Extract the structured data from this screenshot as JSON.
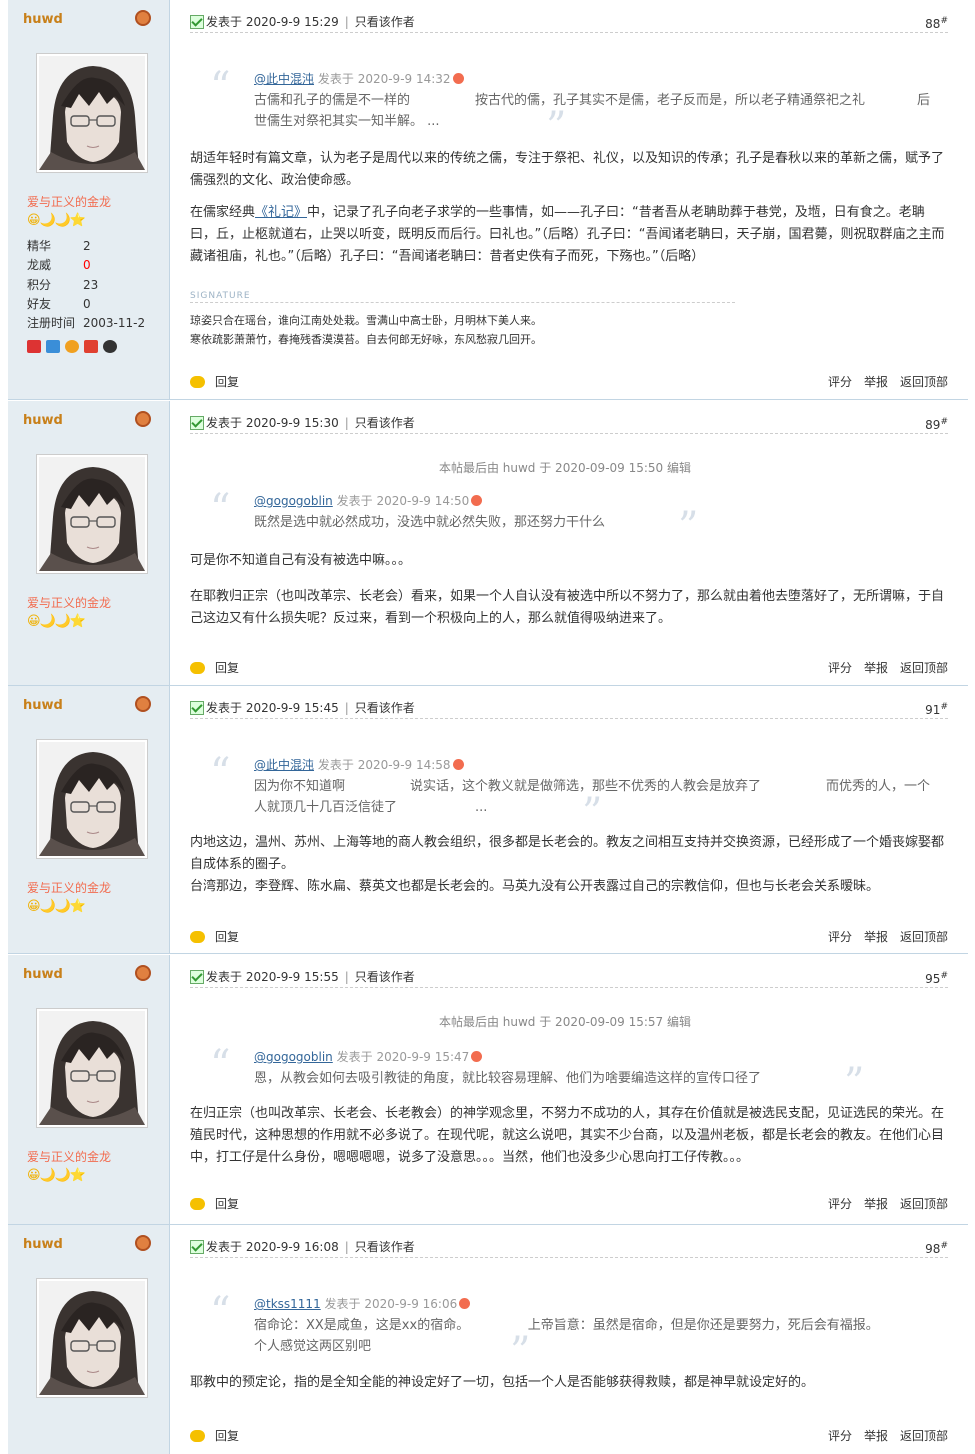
{
  "labels": {
    "posted": "发表于",
    "only_author": "只看该作者",
    "quote_posted": "发表于",
    "reply": "回复",
    "rate": "评分",
    "report": "举报",
    "top": "返回顶部",
    "signature": "SIGNATURE",
    "floor_mark": "#"
  },
  "user": {
    "name": "huwd",
    "rank": "爱与正义的金龙",
    "stars": "😀🌙🌙⭐",
    "stats": [
      {
        "k": "精华",
        "v": "2"
      },
      {
        "k": "龙威",
        "v": "0"
      },
      {
        "k": "积分",
        "v": "23"
      },
      {
        "k": "好友",
        "v": "0"
      },
      {
        "k": "注册时间",
        "v": "2003-11-2"
      }
    ]
  },
  "posts": [
    {
      "floor": "88",
      "time": "2020-9-9 15:29",
      "quote": {
        "user": "@此中混沌",
        "time": "2020-9-9 14:32",
        "text": "古儒和孔子的儒是不一样的　　　　　按古代的儒，孔子其实不是儒，老子反而是，所以老子精通祭祀之礼　　　　后世儒生对祭祀其实一知半解。 ..."
      },
      "p1": "胡适年轻时有篇文章，认为老子是周代以来的传统之儒，专注于祭祀、礼仪，以及知识的传承；孔子是春秋以来的革新之儒，赋予了儒强烈的文化、政治使命感。",
      "p2a": "在儒家经典",
      "p2link": "《礼记》",
      "p2b": "中，记录了孔子向老子求学的一些事情，如——孔子曰：“昔者吾从老聃助葬于巷党，及堩，日有食之。老聃曰，丘，止柩就道右，止哭以听变，既明反而后行。曰礼也。”（后略）孔子曰：“吾闻诸老聃曰，天子崩，国君薨，则祝取群庙之主而藏诸祖庙，礼也。”（后略）孔子曰：“吾闻诸老聃曰：昔者史佚有子而死，下殇也。”（后略）",
      "sig": [
        "琼姿只合在瑶台，谁向江南处处栽。雪满山中高士卧，月明林下美人来。",
        "寒依疏影萧萧竹，春掩残香漠漠苔。自去何郎无好咏，东风愁寂几回开。"
      ]
    },
    {
      "floor": "89",
      "time": "2020-9-9 15:30",
      "edit": "本帖最后由 huwd 于 2020-09-09 15:50 编辑",
      "quote": {
        "user": "@gogogoblin",
        "time": "2020-9-9 14:50",
        "text": "既然是选中就必然成功，没选中就必然失败，那还努力干什么"
      },
      "p1": "可是你不知道自己有没有被选中嘛。。。",
      "p2": "在耶教归正宗（也叫改革宗、长老会）看来，如果一个人自认没有被选中所以不努力了，那么就由着他去堕落好了，无所谓嘛，于自己这边又有什么损失呢？反过来，看到一个积极向上的人，那么就值得吸纳进来了。"
    },
    {
      "floor": "91",
      "time": "2020-9-9 15:45",
      "quote": {
        "user": "@此中混沌",
        "time": "2020-9-9 14:58",
        "text": "因为你不知道啊　　　　　说实话，这个教义就是做筛选，那些不优秀的人教会是放弃了　　　　　而优秀的人，一个人就顶几十几百泛信徒了　　　　　　..."
      },
      "p1": "内地这边，温州、苏州、上海等地的商人教会组织，很多都是长老会的。教友之间相互支持并交换资源，已经形成了一个婚丧嫁娶都自成体系的圈子。",
      "p2": "台湾那边，李登辉、陈水扁、蔡英文也都是长老会的。马英九没有公开表露过自己的宗教信仰，但也与长老会关系暧昧。"
    },
    {
      "floor": "95",
      "time": "2020-9-9 15:55",
      "edit": "本帖最后由 huwd 于 2020-09-09 15:57 编辑",
      "quote": {
        "user": "@gogogoblin",
        "time": "2020-9-9 15:47",
        "text": "恩，从教会如何去吸引教徒的角度，就比较容易理解、他们为啥要编造这样的宣传口径了"
      },
      "p1": "在归正宗（也叫改革宗、长老会、长老教会）的神学观念里，不努力不成功的人，其存在价值就是被选民支配，见证选民的荣光。在殖民时代，这种思想的作用就不必多说了。在现代呢，就这么说吧，其实不少台商，以及温州老板，都是长老会的教友。在他们心目中，打工仔是什么身份，嗯嗯嗯嗯，说多了没意思。。。当然，他们也没多少心思向打工仔传教。。。"
    },
    {
      "floor": "98",
      "time": "2020-9-9 16:08",
      "quote": {
        "user": "@tkss1111",
        "time": "2020-9-9 16:06",
        "text": "宿命论：XX是咸鱼，这是xx的宿命。　　　　　上帝旨意：虽然是宿命，但是你还是要努力，死后会有福报。　　　　　个人感觉这两区别吧"
      },
      "p1": "耶教中的预定论，指的是全知全能的神设定好了一切，包括一个人是否能够获得救赎，都是神早就设定好的。"
    }
  ],
  "colors": {
    "sidebar": "#e5edf2",
    "border": "#c2d5e3",
    "link": "#336699",
    "username": "#c8801a",
    "rank": "#f26c4f"
  }
}
